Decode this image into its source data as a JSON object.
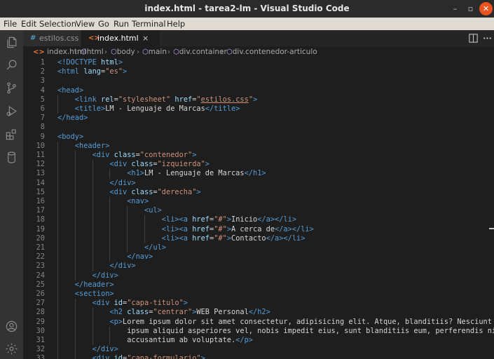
{
  "window": {
    "title": "index.html - tarea2-lm - Visual Studio Code",
    "controls": {
      "minimize": "–",
      "maximize": "▫",
      "close": "✕"
    }
  },
  "menu": [
    "File",
    "Edit",
    "Selection",
    "View",
    "Go",
    "Run",
    "Terminal",
    "Help"
  ],
  "activity_bar": {
    "top": [
      "files-icon",
      "search-icon",
      "source-control-icon",
      "run-debug-icon",
      "extensions-icon",
      "database-icon"
    ],
    "bottom": [
      "account-icon",
      "settings-gear-icon"
    ]
  },
  "tabs": [
    {
      "glyph": "#",
      "label": "estilos.css",
      "active": false,
      "glyph_color": "#519aba"
    },
    {
      "glyph": "<>",
      "label": "index.html",
      "active": true,
      "glyph_color": "#e37933",
      "close": "×"
    }
  ],
  "tab_actions": [
    "split-editor-icon",
    "more-actions-icon"
  ],
  "breadcrumb": [
    "index.html",
    "html",
    "body",
    "main",
    "div.container",
    "div.contenedor-articulo"
  ],
  "editor": {
    "lines": [
      {
        "n": "1",
        "indent": 0,
        "tokens": [
          [
            "tag",
            "<!DOCTYPE "
          ],
          [
            "attr",
            "html"
          ],
          [
            "tag",
            ">"
          ]
        ]
      },
      {
        "n": "2",
        "indent": 0,
        "tokens": [
          [
            "tag",
            "<html "
          ],
          [
            "attr",
            "lang"
          ],
          [
            "text",
            "="
          ],
          [
            "str",
            "\"es\""
          ],
          [
            "tag",
            ">"
          ]
        ]
      },
      {
        "n": "3",
        "indent": 0,
        "tokens": []
      },
      {
        "n": "4",
        "indent": 0,
        "tokens": [
          [
            "tag",
            "<head>"
          ]
        ]
      },
      {
        "n": "5",
        "indent": 1,
        "tokens": [
          [
            "tag",
            "<link "
          ],
          [
            "attr",
            "rel"
          ],
          [
            "text",
            "="
          ],
          [
            "str",
            "\"stylesheet\""
          ],
          [
            "text",
            " "
          ],
          [
            "attr",
            "href"
          ],
          [
            "text",
            "="
          ],
          [
            "str",
            "\""
          ],
          [
            "link",
            "estilos.css"
          ],
          [
            "str",
            "\""
          ],
          [
            "tag",
            ">"
          ]
        ]
      },
      {
        "n": "6",
        "indent": 1,
        "tokens": [
          [
            "tag",
            "<title>"
          ],
          [
            "text",
            "LM - Lenguaje de Marcas"
          ],
          [
            "tag",
            "</title>"
          ]
        ]
      },
      {
        "n": "7",
        "indent": 0,
        "tokens": [
          [
            "tag",
            "</head>"
          ]
        ]
      },
      {
        "n": "8",
        "indent": 0,
        "tokens": []
      },
      {
        "n": "9",
        "indent": 0,
        "tokens": [
          [
            "tag",
            "<body>"
          ]
        ]
      },
      {
        "n": "10",
        "indent": 1,
        "tokens": [
          [
            "tag",
            "<header>"
          ]
        ]
      },
      {
        "n": "11",
        "indent": 2,
        "tokens": [
          [
            "tag",
            "<div "
          ],
          [
            "attr",
            "class"
          ],
          [
            "text",
            "="
          ],
          [
            "str",
            "\"contenedor\""
          ],
          [
            "tag",
            ">"
          ]
        ]
      },
      {
        "n": "12",
        "indent": 3,
        "tokens": [
          [
            "tag",
            "<div "
          ],
          [
            "attr",
            "class"
          ],
          [
            "text",
            "="
          ],
          [
            "str",
            "\"izquierda\""
          ],
          [
            "tag",
            ">"
          ]
        ]
      },
      {
        "n": "13",
        "indent": 4,
        "tokens": [
          [
            "tag",
            "<h1>"
          ],
          [
            "text",
            "LM - Lenguaje de Marcas"
          ],
          [
            "tag",
            "</h1>"
          ]
        ]
      },
      {
        "n": "14",
        "indent": 3,
        "tokens": [
          [
            "tag",
            "</div>"
          ]
        ]
      },
      {
        "n": "15",
        "indent": 3,
        "tokens": [
          [
            "tag",
            "<div "
          ],
          [
            "attr",
            "class"
          ],
          [
            "text",
            "="
          ],
          [
            "str",
            "\"derecha\""
          ],
          [
            "tag",
            ">"
          ]
        ]
      },
      {
        "n": "16",
        "indent": 4,
        "tokens": [
          [
            "tag",
            "<nav>"
          ]
        ]
      },
      {
        "n": "17",
        "indent": 5,
        "tokens": [
          [
            "tag",
            "<ul>"
          ]
        ]
      },
      {
        "n": "18",
        "indent": 6,
        "tokens": [
          [
            "tag",
            "<li><a "
          ],
          [
            "attr",
            "href"
          ],
          [
            "text",
            "="
          ],
          [
            "str",
            "\"#\""
          ],
          [
            "tag",
            ">"
          ],
          [
            "text",
            "Inicio"
          ],
          [
            "tag",
            "</a></li>"
          ]
        ]
      },
      {
        "n": "19",
        "indent": 6,
        "tokens": [
          [
            "tag",
            "<li><a "
          ],
          [
            "attr",
            "href"
          ],
          [
            "text",
            "="
          ],
          [
            "str",
            "\"#\""
          ],
          [
            "tag",
            ">"
          ],
          [
            "text",
            "A cerca de"
          ],
          [
            "tag",
            "</a></li>"
          ]
        ]
      },
      {
        "n": "20",
        "indent": 6,
        "tokens": [
          [
            "tag",
            "<li><a "
          ],
          [
            "attr",
            "href"
          ],
          [
            "text",
            "="
          ],
          [
            "str",
            "\"#\""
          ],
          [
            "tag",
            ">"
          ],
          [
            "text",
            "Contacto"
          ],
          [
            "tag",
            "</a></li>"
          ]
        ]
      },
      {
        "n": "21",
        "indent": 5,
        "tokens": [
          [
            "tag",
            "</ul>"
          ]
        ]
      },
      {
        "n": "22",
        "indent": 4,
        "tokens": [
          [
            "tag",
            "</nav>"
          ]
        ]
      },
      {
        "n": "23",
        "indent": 3,
        "tokens": [
          [
            "tag",
            "</div>"
          ]
        ]
      },
      {
        "n": "24",
        "indent": 2,
        "tokens": [
          [
            "tag",
            "</div>"
          ]
        ]
      },
      {
        "n": "25",
        "indent": 1,
        "tokens": [
          [
            "tag",
            "</header>"
          ]
        ]
      },
      {
        "n": "26",
        "indent": 1,
        "tokens": [
          [
            "tag",
            "<section>"
          ]
        ]
      },
      {
        "n": "27",
        "indent": 2,
        "tokens": [
          [
            "tag",
            "<div "
          ],
          [
            "attr",
            "id"
          ],
          [
            "text",
            "="
          ],
          [
            "str",
            "\"capa-titulo\""
          ],
          [
            "tag",
            ">"
          ]
        ]
      },
      {
        "n": "28",
        "indent": 3,
        "tokens": [
          [
            "tag",
            "<h2 "
          ],
          [
            "attr",
            "class"
          ],
          [
            "text",
            "="
          ],
          [
            "str",
            "\"centrar\""
          ],
          [
            "tag",
            ">"
          ],
          [
            "text",
            "WEB Personal"
          ],
          [
            "tag",
            "</h2>"
          ]
        ]
      },
      {
        "n": "29",
        "indent": 3,
        "tokens": [
          [
            "tag",
            "<p>"
          ],
          [
            "text",
            "Lorem ipsum dolor sit amet consectetur, adipisicing elit. Atque, blanditiis? Nesciunt debitis"
          ]
        ]
      },
      {
        "n": "30",
        "indent": 4,
        "tokens": [
          [
            "text",
            "ipsum aliquid asperiores vel, nobis impedit eius, sunt blanditiis eum, perferendis nisi aut"
          ]
        ]
      },
      {
        "n": "31",
        "indent": 4,
        "tokens": [
          [
            "text",
            "accusantium ab voluptate."
          ],
          [
            "tag",
            "</p>"
          ]
        ]
      },
      {
        "n": "32",
        "indent": 2,
        "tokens": [
          [
            "tag",
            "</div>"
          ]
        ]
      },
      {
        "n": "33",
        "indent": 2,
        "tokens": [
          [
            "tag",
            "<div "
          ],
          [
            "attr",
            "id"
          ],
          [
            "text",
            "="
          ],
          [
            "str",
            "\"capa-formulario\""
          ],
          [
            "tag",
            ">"
          ]
        ]
      }
    ]
  }
}
